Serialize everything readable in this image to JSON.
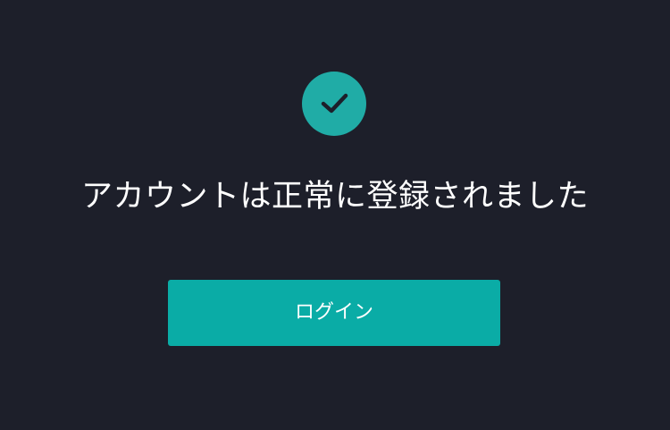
{
  "colors": {
    "background": "#1d1f2a",
    "accent": "#0aaca6",
    "icon_circle": "#20aca6",
    "text": "#ffffff",
    "check": "#1d1f2a"
  },
  "success": {
    "icon": "check-icon",
    "message": "アカウントは正常に登録されました"
  },
  "actions": {
    "login_label": "ログイン"
  }
}
